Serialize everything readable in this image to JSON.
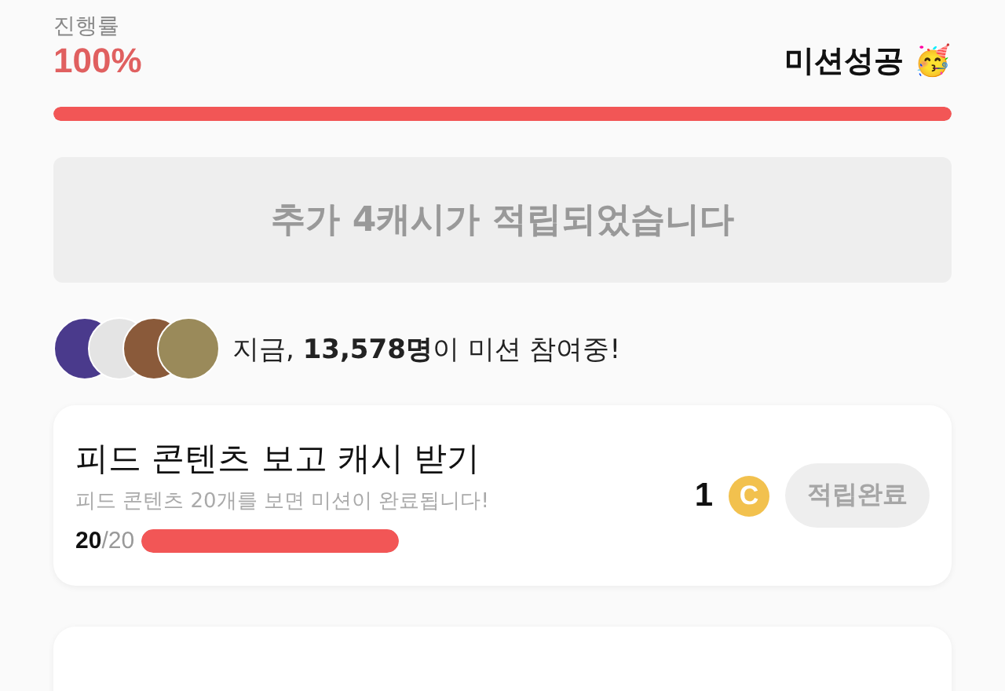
{
  "progress": {
    "label": "진행률",
    "value": "100%",
    "level": 1,
    "status": "미션성공",
    "status_emoji": "🥳"
  },
  "banner": {
    "text": "추가 4캐시가 적립되었습니다"
  },
  "participants": {
    "text": "지금, **13,578명**이 미션 참여중!"
  },
  "missions": [
    {
      "title": "피드 콘텐츠 보고 캐시 받기",
      "description": "피드 콘텐츠 20개를 보면 미션이 완료됩니다!",
      "count": "**20**/20",
      "level": 1,
      "reward": "1",
      "coin": "C",
      "button": "적립완료",
      "disabled": true
    }
  ]
}
